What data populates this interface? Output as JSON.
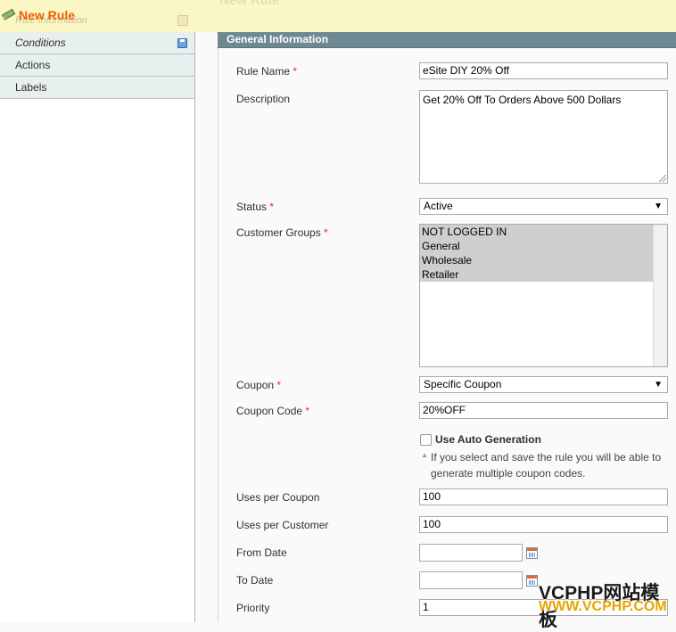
{
  "header": {
    "title": "New Rule",
    "ghost_tab": "Rule Information",
    "ghost_heading": "New Rule"
  },
  "tabs": [
    {
      "label": "Conditions",
      "active": true
    },
    {
      "label": "Actions",
      "active": false
    },
    {
      "label": "Labels",
      "active": false
    }
  ],
  "section": {
    "title": "General Information"
  },
  "form": {
    "rule_name": {
      "label": "Rule Name",
      "value": "eSite DIY 20% Off",
      "required": "*"
    },
    "description": {
      "label": "Description",
      "value": "Get 20% Off To Orders Above 500 Dollars"
    },
    "status": {
      "label": "Status",
      "value": "Active",
      "required": "*"
    },
    "customer_groups": {
      "label": "Customer Groups",
      "required": "*",
      "options": [
        "NOT LOGGED IN",
        "General",
        "Wholesale",
        "Retailer"
      ]
    },
    "coupon": {
      "label": "Coupon",
      "value": "Specific Coupon",
      "required": "*"
    },
    "coupon_code": {
      "label": "Coupon Code",
      "value": "20%OFF",
      "required": "*"
    },
    "auto_generation": {
      "label": "Use Auto Generation",
      "note": "If you select and save the rule you will be able to generate multiple coupon codes."
    },
    "uses_per_coupon": {
      "label": "Uses per Coupon",
      "value": "100"
    },
    "uses_per_customer": {
      "label": "Uses per Customer",
      "value": "100"
    },
    "from_date": {
      "label": "From Date",
      "value": ""
    },
    "to_date": {
      "label": "To Date",
      "value": ""
    },
    "priority": {
      "label": "Priority",
      "value": "1"
    }
  },
  "watermark": {
    "line1": "VCPHP网站模板",
    "line2": "WWW.VCPHP.COM"
  },
  "colors": {
    "title": "#eb5e00",
    "section_header": "#6f8992",
    "required": "#eb340a"
  },
  "icons": [
    "pencil-icon",
    "save-icon",
    "dropdown-arrow-icon",
    "calendar-icon",
    "note-arrow-icon"
  ]
}
